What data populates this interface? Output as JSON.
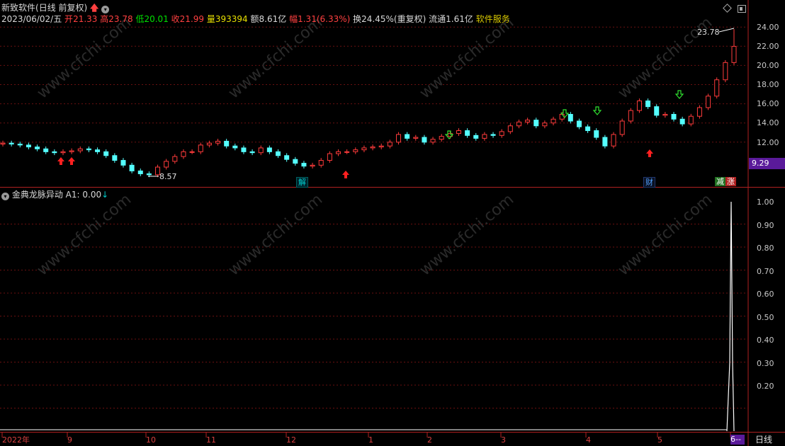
{
  "title_bar": {
    "stock_name": "新致软件",
    "mode": "(日线 前复权)"
  },
  "quote": {
    "date": "2023/06/02/五",
    "open_label": "开",
    "open": "21.33",
    "high_label": "高",
    "high": "23.78",
    "low_label": "低",
    "low": "20.01",
    "close_label": "收",
    "close": "21.99",
    "vol_label": "量",
    "volume": "393394",
    "amount_label": "额",
    "amount": "8.61亿",
    "change_label": "幅",
    "change": "1.31(6.33%)",
    "turnover_label": "换",
    "turnover": "24.45%(重复权)",
    "float_label": "流通",
    "float_cap": "1.61亿",
    "sector": "软件服务"
  },
  "price_axis": [
    "24.00",
    "22.00",
    "20.00",
    "18.00",
    "16.00",
    "14.00",
    "12.00"
  ],
  "price_badge": "9.29",
  "high_marker": "23.78",
  "low_marker": "8.57",
  "event_labels": {
    "jie": "解",
    "cai": "财",
    "jian": "减",
    "zhang": "涨"
  },
  "indicator": {
    "name": "金典龙脉异动",
    "value_text": "A1: 0.00"
  },
  "indicator_axis": [
    "1.00",
    "0.90",
    "0.80",
    "0.70",
    "0.60",
    "0.50",
    "0.40",
    "0.30",
    "0.20"
  ],
  "x_axis": {
    "labels": [
      "2022年",
      "9",
      "10",
      "11",
      "12",
      "1",
      "2",
      "3",
      "4",
      "5",
      "6"
    ],
    "period_button": "日线",
    "more": "--"
  },
  "watermark": "www.cfchi.com",
  "colors": {
    "up": "#ff3b3b",
    "down": "#54ffff",
    "grid": "#6a1010",
    "bg": "#000000",
    "badge": "#5a1a9a"
  },
  "chart_data": {
    "type": "candlestick",
    "months": [
      "2022-08",
      "2022-09",
      "2022-10",
      "2022-11",
      "2022-12",
      "2023-01",
      "2023-02",
      "2023-03",
      "2023-04",
      "2023-05",
      "2023-06"
    ],
    "close": [
      11.9,
      11.8,
      11.7,
      11.5,
      11.3,
      11.0,
      10.9,
      11.0,
      11.1,
      11.3,
      11.2,
      11.0,
      10.6,
      10.1,
      9.6,
      9.0,
      8.7,
      8.6,
      9.4,
      10.0,
      10.5,
      11.0,
      11.0,
      11.7,
      11.9,
      12.1,
      11.6,
      11.4,
      11.0,
      10.9,
      11.4,
      11.0,
      10.6,
      10.2,
      9.8,
      9.5,
      9.6,
      10.1,
      10.8,
      11.0,
      11.0,
      11.2,
      11.4,
      11.5,
      11.6,
      12.0,
      12.8,
      12.4,
      12.5,
      12.0,
      12.3,
      12.6,
      12.9,
      13.2,
      12.7,
      12.4,
      12.8,
      12.7,
      13.1,
      13.7,
      14.1,
      14.3,
      13.7,
      14.0,
      14.4,
      14.9,
      14.2,
      13.6,
      13.2,
      12.5,
      11.6,
      12.8,
      14.2,
      15.3,
      16.3,
      15.7,
      14.8,
      14.9,
      14.4,
      13.9,
      14.7,
      15.6,
      16.8,
      18.5,
      20.3,
      21.99
    ],
    "marks": {
      "period_high": 23.78,
      "period_low": 8.57
    },
    "indicator_A1": {
      "last": 0.0,
      "spike_max": 1.0,
      "range": [
        0,
        1.0
      ]
    }
  }
}
